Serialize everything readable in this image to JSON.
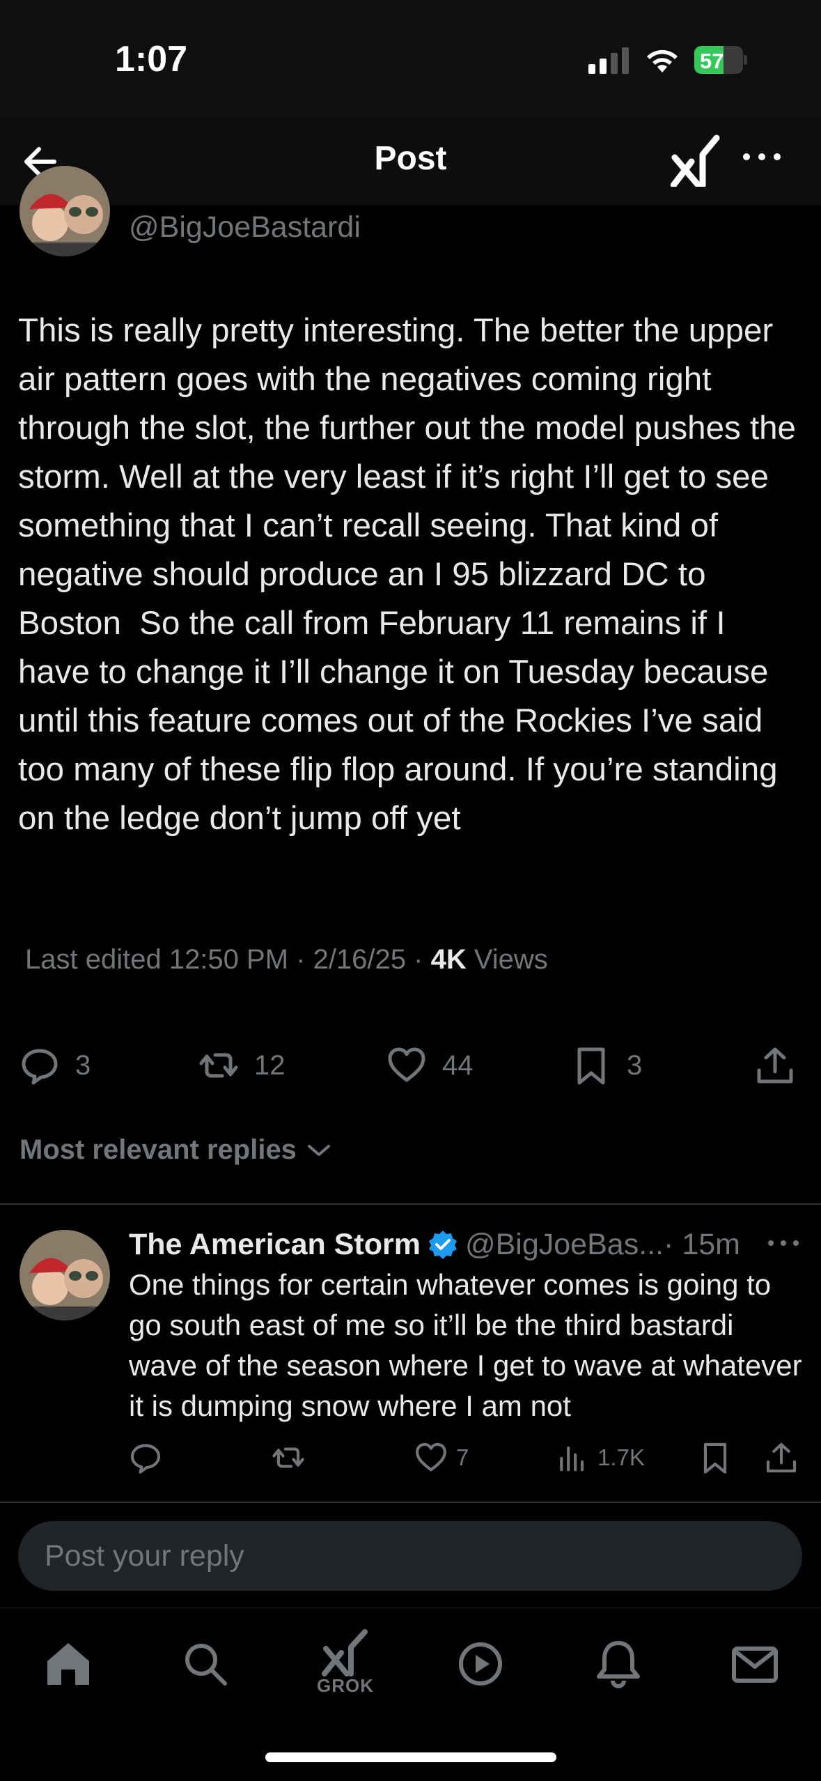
{
  "status": {
    "time": "1:07",
    "battery": "57"
  },
  "header": {
    "title": "Post"
  },
  "tweet": {
    "handle": "@BigJoeBastardi",
    "text": "This is really pretty interesting. The better the upper air pattern goes with the negatives coming right through the slot, the further out the model pushes the storm. Well at the very least if it’s right I’ll get to see something that I can’t recall seeing. That kind of negative should produce an I 95 blizzard DC to Boston  So the call from February 11 remains if I have to change it I’ll change it on Tuesday because until this feature comes out of the Rockies I’ve said too many of these flip flop around. If you’re standing on the ledge don’t jump off yet",
    "meta_prefix": "Last edited 12:50 PM · 2/16/25 · ",
    "views_count": "4K",
    "views_label": " Views",
    "stats": {
      "replies": "3",
      "reposts": "12",
      "likes": "44",
      "bookmarks": "3"
    }
  },
  "replies_sort": {
    "label": "Most relevant replies"
  },
  "reply": {
    "name": "The American Storm",
    "handle": "@BigJoeBas...",
    "time": "· 15m",
    "text": "One things for certain whatever comes is going to go south east of me so it’ll be the third bastardi wave of the season where I get to wave at whatever it is dumping snow where I am not",
    "likes": "7",
    "views": "1.7K"
  },
  "compose": {
    "placeholder": "Post your reply"
  },
  "bottom_nav": {
    "grok_label": "GROK"
  },
  "colors": {
    "background": "#000000",
    "text": "#e7e9ea",
    "muted": "#71767b",
    "verified": "#1d9bf0",
    "battery": "#34c759"
  }
}
